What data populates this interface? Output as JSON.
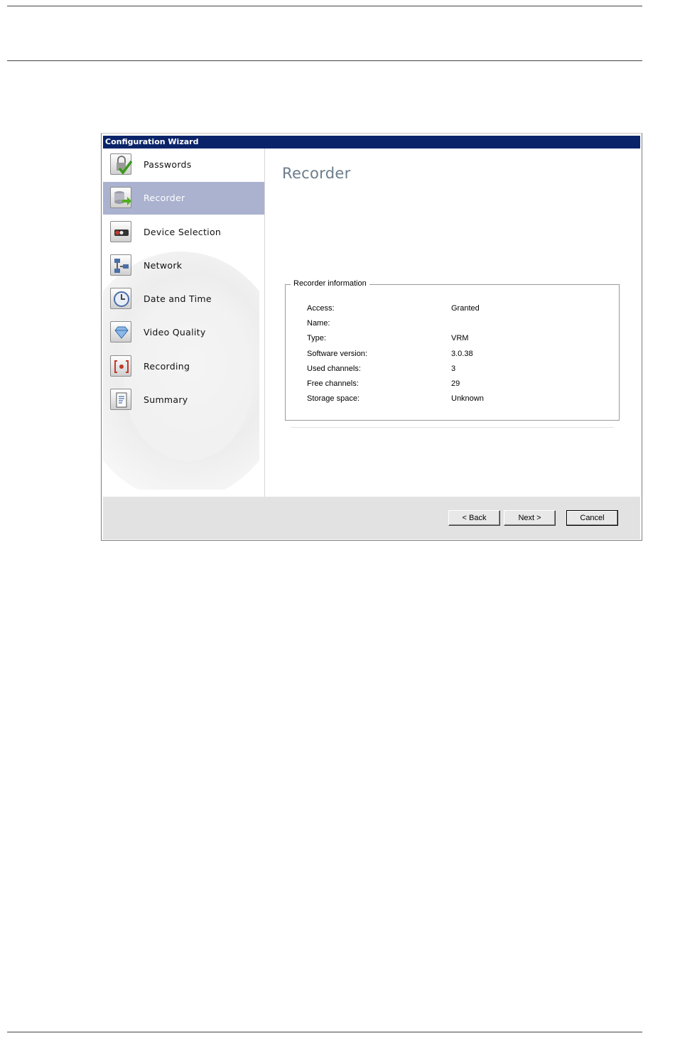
{
  "window": {
    "title": "Configuration Wizard"
  },
  "sidebar": {
    "items": [
      {
        "label": "Passwords",
        "icon": "lock-check-icon"
      },
      {
        "label": "Recorder",
        "icon": "database-arrow-icon",
        "active": true
      },
      {
        "label": "Device Selection",
        "icon": "camera-icon"
      },
      {
        "label": "Network",
        "icon": "network-icon"
      },
      {
        "label": "Date and Time",
        "icon": "clock-icon"
      },
      {
        "label": "Video Quality",
        "icon": "diamond-icon"
      },
      {
        "label": "Recording",
        "icon": "record-icon"
      },
      {
        "label": "Summary",
        "icon": "document-icon"
      }
    ]
  },
  "main": {
    "title": "Recorder",
    "group": {
      "legend": "Recorder information",
      "rows": [
        {
          "label": "Access:",
          "value": "Granted"
        },
        {
          "label": "Name:",
          "value": ""
        },
        {
          "label": "Type:",
          "value": "VRM"
        },
        {
          "label": "Software version:",
          "value": "3.0.38"
        },
        {
          "label": "Used channels:",
          "value": "3"
        },
        {
          "label": "Free channels:",
          "value": "29"
        },
        {
          "label": "Storage space:",
          "value": "Unknown"
        }
      ]
    }
  },
  "footer": {
    "back_label": "< Back",
    "next_label": "Next >",
    "cancel_label": "Cancel"
  },
  "colors": {
    "title_bar": "#0a246a",
    "active_item": "#aab2cf",
    "page_title": "#6b7c8c"
  }
}
